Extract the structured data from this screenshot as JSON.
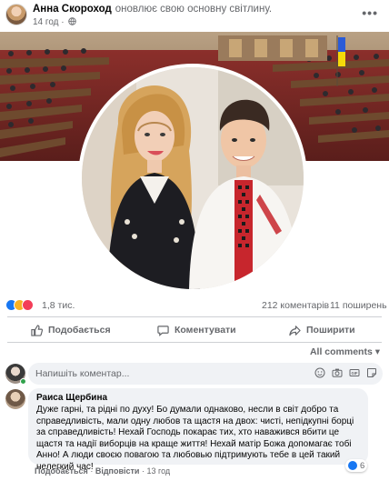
{
  "post": {
    "author": "Анна Скороход",
    "action": "оновлює свою основну світлину.",
    "time": "14 год",
    "separator": "·"
  },
  "stats": {
    "reactions_count": "1,8 тис.",
    "comments": "212 коментарів",
    "shares": "11 поширень"
  },
  "actions": {
    "like": "Подобається",
    "comment": "Коментувати",
    "share": "Поширити"
  },
  "sort": {
    "label": "All comments"
  },
  "composer": {
    "placeholder": "Напишіть коментар..."
  },
  "comment": {
    "author": "Раиса Щербина",
    "text": "Дуже гарні, та рідні по духу! Бо думали однаково, несли в світ добро та справедливість, мали одну любов та щастя на двох: чисті, непідкупні борці за справедливість! Нехай Господь покарає тих, хто наважився вбити це щастя та надії виборців на краще життя! Нехай матір Божа допомагає тобі Анно! А люди своєю повагою та любовью підтримують тебе в цей такий нелегкий час!",
    "reaction_count": "6",
    "like": "Подобається",
    "reply": "Відповісти",
    "time": "13 год",
    "separator": "·"
  },
  "colors": {
    "facebook_blue": "#1877f2",
    "secondary_text": "#65676b",
    "bubble_bg": "#f0f2f5",
    "haha_yellow": "#f7b125",
    "love_red": "#f33e58",
    "online_green": "#31a24c"
  },
  "icons": {
    "privacy": "globe-icon",
    "menu": "more-horizontal-icon",
    "like": "thumbs-up-icon",
    "comment": "speech-bubble-icon",
    "share": "share-arrow-icon",
    "sort": "caret-down-icon"
  }
}
